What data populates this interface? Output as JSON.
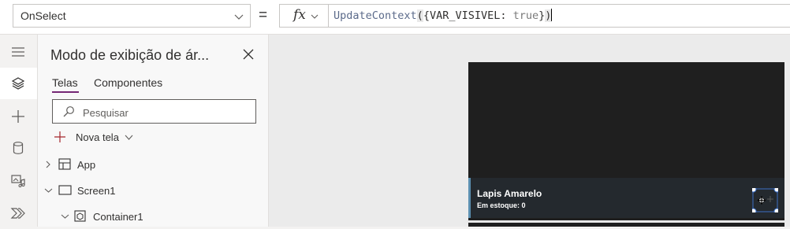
{
  "formula_bar": {
    "property": "OnSelect",
    "equals": "=",
    "fx_label": "fx",
    "formula": {
      "fn": "UpdateContext",
      "open": "(",
      "arg": "{VAR_VISIVEL: ",
      "kw": "true",
      "close_brace": "}",
      "close": ")"
    }
  },
  "left_rail": {
    "items": [
      {
        "icon": "hamburger-icon"
      },
      {
        "icon": "layers-icon",
        "active": true
      },
      {
        "icon": "plus-icon"
      },
      {
        "icon": "database-icon"
      },
      {
        "icon": "media-icon"
      },
      {
        "icon": "power-automate-icon"
      }
    ]
  },
  "tree_panel": {
    "title": "Modo de exibição de ár...",
    "tabs": [
      {
        "label": "Telas",
        "active": true
      },
      {
        "label": "Componentes",
        "active": false
      }
    ],
    "search_placeholder": "Pesquisar",
    "new_screen_label": "Nova tela",
    "tree": [
      {
        "label": "App",
        "icon": "app-icon",
        "expanded": false
      },
      {
        "label": "Screen1",
        "icon": "screen-icon",
        "expanded": true
      },
      {
        "label": "Container1",
        "icon": "container-icon",
        "expanded": true
      }
    ]
  },
  "canvas": {
    "gallery_item": {
      "title": "Lapis Amarelo",
      "subtitle": "Em estoque: 0"
    }
  },
  "colors": {
    "accent": "#742774",
    "canvas_bg": "#ebebeb",
    "app_bg": "#1f1f1f",
    "selection": "#3b6ec4"
  }
}
